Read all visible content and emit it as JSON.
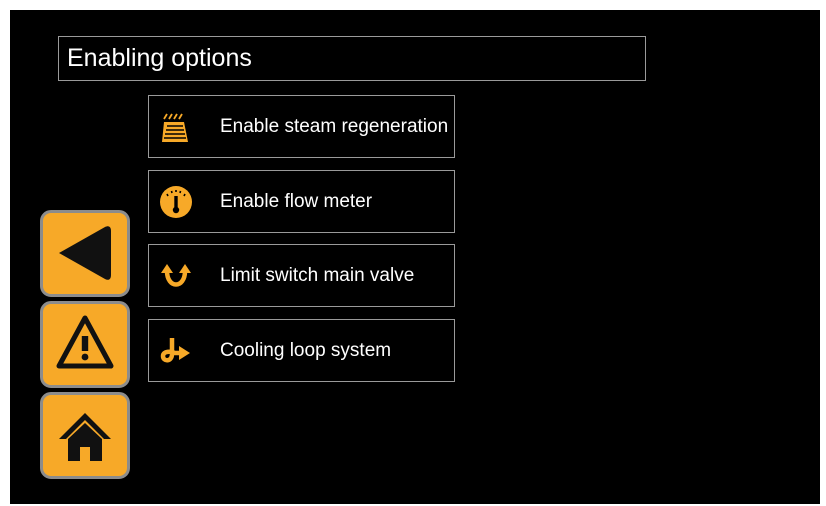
{
  "page": {
    "title": "Enabling options"
  },
  "options": [
    {
      "label": "Enable steam regeneration",
      "icon": "steam-regeneration-icon"
    },
    {
      "label": "Enable flow meter",
      "icon": "flow-meter-gauge-icon"
    },
    {
      "label": "Limit switch main valve",
      "icon": "limit-switch-arrows-icon"
    },
    {
      "label": "Cooling loop system",
      "icon": "cooling-loop-pipe-icon"
    }
  ],
  "side_buttons": [
    {
      "name": "back",
      "icon": "back-arrow-icon"
    },
    {
      "name": "alarm",
      "icon": "warning-triangle-icon"
    },
    {
      "name": "home",
      "icon": "home-icon"
    }
  ],
  "colors": {
    "accent": "#f7a928",
    "background": "#000000",
    "border": "#9a9a9a",
    "text": "#ffffff"
  }
}
